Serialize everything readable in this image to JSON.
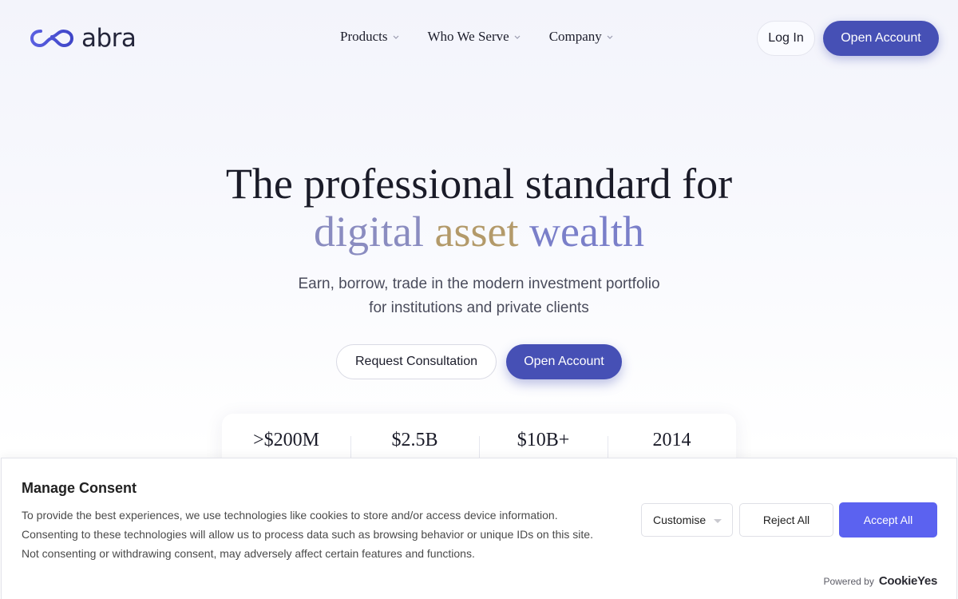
{
  "header": {
    "logo_text": "abra",
    "nav": [
      {
        "label": "Products"
      },
      {
        "label": "Who We Serve"
      },
      {
        "label": "Company"
      }
    ],
    "login_label": "Log In",
    "open_account_label": "Open Account"
  },
  "hero": {
    "title_line1": "The professional standard for",
    "title_word1": "digital",
    "title_word2": "asset",
    "title_word3": "wealth",
    "subtitle_line1": "Earn, borrow, trade in the modern investment portfolio",
    "subtitle_line2": "for institutions and private clients",
    "consult_label": "Request Consultation",
    "open_account_label": "Open Account"
  },
  "stats": [
    ">$200M",
    "$2.5B",
    "$10B+",
    "2014"
  ],
  "consent": {
    "title": "Manage Consent",
    "text_line1": "To provide the best experiences, we use technologies like cookies to store and/or access device information.",
    "text_line2": "Consenting to these technologies will allow us to process data such as browsing behavior or unique IDs on this site.",
    "text_line3": "Not consenting or withdrawing consent, may adversely affect certain features and functions.",
    "customise_label": "Customise",
    "reject_label": "Reject All",
    "accept_label": "Accept All",
    "powered_by": "Powered by",
    "brand": "CookieYes"
  },
  "colors": {
    "primary": "#4650b5",
    "accept": "#5b62f0",
    "gold": "#b39a6a",
    "lavender": "#8a8cc0"
  }
}
